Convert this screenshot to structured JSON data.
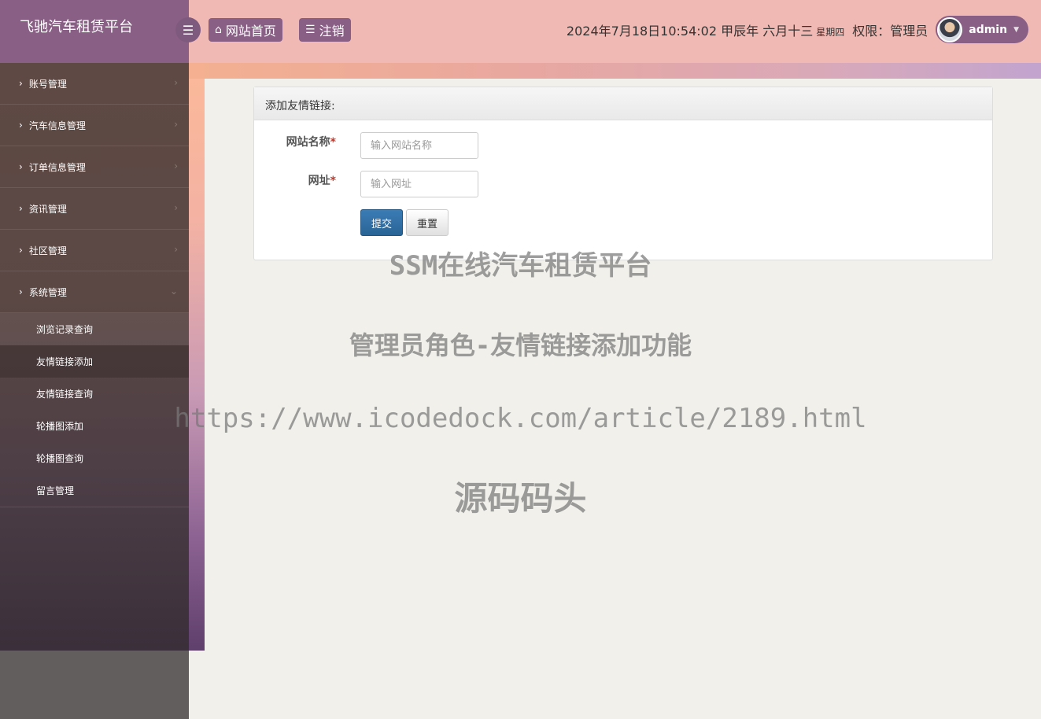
{
  "app": {
    "title": "飞驰汽车租赁平台"
  },
  "topbar": {
    "toggle_icon": "menu-icon",
    "home_label": "网站首页",
    "logout_label": "注销",
    "datetime": "2024年7月18日10:54:02 甲辰年 六月十三",
    "weekday": "星期四",
    "permission": "权限：管理员",
    "username": "admin"
  },
  "sidebar": {
    "items": [
      {
        "label": "账号管理"
      },
      {
        "label": "汽车信息管理"
      },
      {
        "label": "订单信息管理"
      },
      {
        "label": "资讯管理"
      },
      {
        "label": "社区管理"
      },
      {
        "label": "系统管理"
      }
    ],
    "subitems": [
      {
        "label": "浏览记录查询"
      },
      {
        "label": "友情链接添加"
      },
      {
        "label": "友情链接查询"
      },
      {
        "label": "轮播图添加"
      },
      {
        "label": "轮播图查询"
      },
      {
        "label": "留言管理"
      }
    ]
  },
  "form": {
    "title": "添加友情链接:",
    "name_label": "网站名称",
    "name_placeholder": "输入网站名称",
    "url_label": "网址",
    "url_placeholder": "输入网址",
    "required_mark": "*",
    "submit_label": "提交",
    "reset_label": "重置"
  },
  "watermark": {
    "line1": "SSM在线汽车租赁平台",
    "line2": "管理员角色-友情链接添加功能",
    "line3": "https://www.icodedock.com/article/2189.html",
    "line4": "源码码头"
  },
  "colors": {
    "brand": "#8a5f86",
    "topbar": "#f0b9b3",
    "submit": "#2a6496"
  }
}
